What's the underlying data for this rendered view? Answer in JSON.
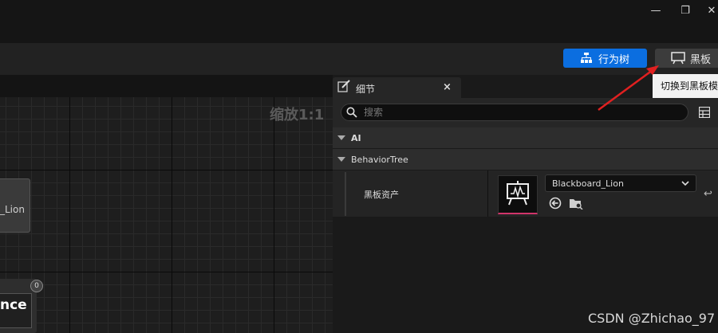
{
  "window": {
    "minimize": "—",
    "maximize": "❐",
    "close": "✕"
  },
  "toolbar": {
    "behavior_tree_button": "行为树",
    "blackboard_button": "黑板",
    "tooltip": "切换到黑板模"
  },
  "graph": {
    "zoom_label": "缩放1:1",
    "node1_label": "_Lion",
    "node2_label": "nce",
    "node2_badge": "0"
  },
  "details": {
    "tab_title": "细节",
    "tab_close": "×",
    "search_placeholder": "搜索",
    "categories": [
      {
        "label": "AI"
      },
      {
        "label": "BehaviorTree"
      }
    ],
    "property": {
      "label": "黑板资产",
      "value": "Blackboard_Lion"
    }
  },
  "watermark": "CSDN @Zhichao_97",
  "colors": {
    "accent": "#0b6ee0",
    "arrow": "#e02020",
    "thumb_underline": "#d0346a"
  },
  "icons": [
    "tree-icon",
    "blackboard-icon",
    "pencil-icon",
    "search-icon",
    "grid-icon",
    "use-selected-icon",
    "browse-icon",
    "reset-icon",
    "chevron-down-icon"
  ]
}
